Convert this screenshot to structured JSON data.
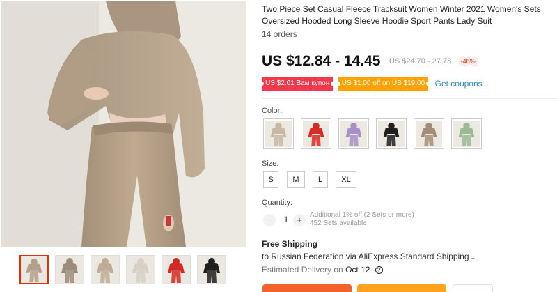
{
  "product": {
    "title": "Two Piece Set Casual Fleece Tracksuit Women Winter 2021 Women's Sets Oversized Hooded Long Sleeve Hoodie Sport Pants Lady Suit",
    "orders": "14 orders",
    "price": "US $12.84 - 14.45",
    "old_price": "US $24.70 - 27.78",
    "discount": "-48%"
  },
  "coupons": {
    "items": [
      "US $2.01 Вам купон",
      "US $1.00 off on US $19.00"
    ],
    "get_label": "Get coupons"
  },
  "color": {
    "label": "Color:",
    "swatches": [
      "beige",
      "red",
      "lilac",
      "black",
      "taupe",
      "sage green"
    ]
  },
  "size": {
    "label": "Size:",
    "options": [
      "S",
      "M",
      "L",
      "XL"
    ]
  },
  "quantity": {
    "label": "Quantity:",
    "value": "1",
    "minus": "−",
    "plus": "+",
    "note": "Additional 1% off (2 Sets or more)",
    "available": "452 Sets available"
  },
  "shipping": {
    "title": "Free Shipping",
    "line": "to Russian Federation via AliExpress Standard Shipping",
    "delivery_prefix": "Estimated Delivery on",
    "delivery_date": "Oct 12",
    "help": "?"
  },
  "icons": {
    "chevron": "chevron-down-icon",
    "help": "question-icon",
    "swatch_colors": [
      "#c9b9a4",
      "#d92b25",
      "#a98fc6",
      "#1f1f1f",
      "#a38d78",
      "#9dba96"
    ],
    "thumb_colors": [
      "#b4a08a",
      "#9c8b79",
      "#c0ab94",
      "#d6d0c6",
      "#d52a24",
      "#202020"
    ]
  },
  "colors": {
    "accent": "#e62e04",
    "coupon_red": "#f2384c",
    "coupon_orange": "#ffa200",
    "link": "#1d8ecf",
    "buy_button": "#f4622c",
    "cart_button": "#ffa21c"
  }
}
